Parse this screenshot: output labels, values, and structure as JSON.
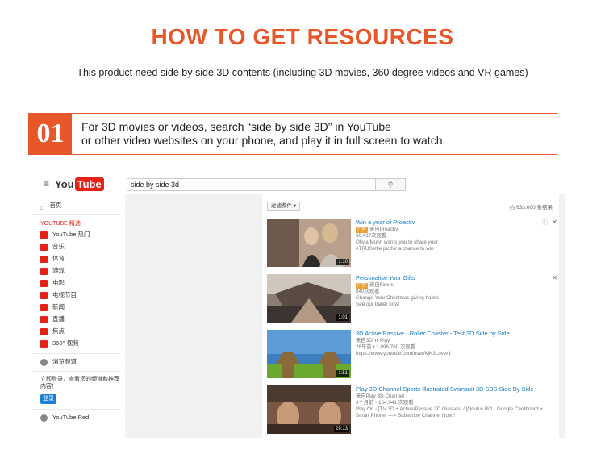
{
  "header": {
    "title": "HOW TO GET RESOURCES",
    "subtitle": "This product need side by side 3D contents (including 3D movies, 360 degree videos and VR games)"
  },
  "step": {
    "number": "01",
    "line1": "For 3D movies or videos, search “side by side 3D” in YouTube",
    "line2": "or other video websites on your phone, and play it in full screen to watch."
  },
  "youtube": {
    "logo_you": "You",
    "logo_tube": "Tube",
    "search": {
      "value": "side by side 3d"
    },
    "sidebar": {
      "home": "首页",
      "heading": "YOUTUBE 精选",
      "items": [
        "YouTube 热门",
        "音乐",
        "体育",
        "游戏",
        "电影",
        "电视节目",
        "新闻",
        "直播",
        "焦点",
        "360° 视频"
      ],
      "browse": "浏览频道",
      "login_text": "立即登录，查看您的频道和推荐内容！",
      "login_button": "登录",
      "red": "YouTube Red"
    },
    "filter_label": "过滤条件 ▾",
    "result_count": "约 633,000 条结果",
    "results": [
      {
        "title": "Win a year of Proactiv",
        "ad_badge": "广告",
        "lines": [
          "来自Proactiv",
          "30,417次观看",
          "Olivia Munn wants you to share your",
          "#TRUSelfie pic for a chance to win"
        ],
        "duration": "1:10",
        "colors": [
          "#7a5a48",
          "#d9c2a8",
          "#2e2a28"
        ]
      },
      {
        "title": "Personalise Your Gifts",
        "ad_badge": "广告",
        "lines": [
          "来自Fixers",
          "840次观看",
          "Change Your Christmas giving habits",
          "See our trailer now!"
        ],
        "duration": "1:01",
        "colors": [
          "#5b5450",
          "#c9b8a4",
          "#8a7a6a"
        ]
      },
      {
        "title": "3D Active/Passive - Roller Coaster - Test 3D Side by Side",
        "lines": [
          "来自3D 'n' Play",
          "28年前 • 1,096,760 次观看",
          "https://www.youtube.com/user/MK3Lover1"
        ],
        "duration": "1:51",
        "colors": [
          "#2f6fb0",
          "#7bb33a",
          "#c8d9e8"
        ]
      },
      {
        "title": "Play 3D Channel Sports Illustrated Swimsuit 3D SBS Side By Side",
        "lines": [
          "来自Play 3D Channel",
          "3个月前 • 164,041 次观看",
          "Play On - [TV 3D + Active/Passive 3D Glasses] / [Oculus Rift - Google Cardboard +",
          "Smart Phone] ---> Subscribe Channel Now !"
        ],
        "duration": "29:13",
        "colors": [
          "#6b4a3a",
          "#c99a78",
          "#3a2a22"
        ]
      }
    ]
  }
}
